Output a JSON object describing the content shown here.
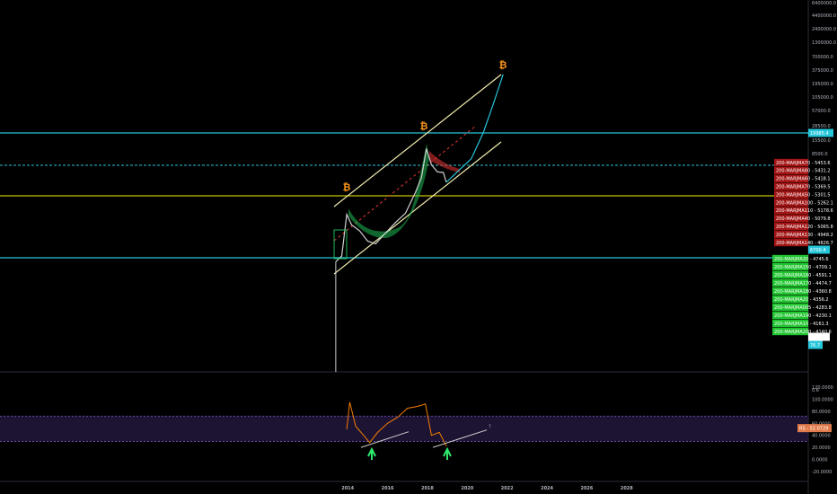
{
  "chart_data": [
    {
      "type": "line",
      "title": "",
      "y_scale": "log",
      "x_ticks": [
        "2014",
        "2016",
        "2018",
        "2020",
        "2022",
        "2024",
        "2026",
        "2028"
      ],
      "y_ticks": [
        "6400000.0",
        "4400000.0",
        "2400000.0",
        "1300000.0",
        "700000.0",
        "375000.0",
        "195000.0",
        "105000.0",
        "57000.0",
        "28500.0",
        "15500.0",
        "8500.0",
        "0.6"
      ],
      "price_label": "19985.4",
      "current_price_label": "1183.6",
      "level_tags": [
        {
          "text": "6700.4",
          "color": "#00bcd4"
        },
        {
          "text": "76.7",
          "color": "#00bcd4"
        }
      ],
      "ma_labels_red": [
        {
          "name": "200-MARJMA70",
          "value": "5453.6"
        },
        {
          "name": "200-MARJMA80",
          "value": "5431.2"
        },
        {
          "name": "200-MARJMA60",
          "value": "5418.1"
        },
        {
          "name": "200-MARJMA70",
          "value": "5369.5"
        },
        {
          "name": "200-MARJMA50",
          "value": "5301.5"
        },
        {
          "name": "200-MARJMA100",
          "value": "5262.1"
        },
        {
          "name": "200-MARJMA110",
          "value": "5178.6"
        },
        {
          "name": "200-MARJMA40",
          "value": "5079.8"
        },
        {
          "name": "200-MARJMA120",
          "value": "5065.8"
        },
        {
          "name": "200-MARJMA130",
          "value": "4948.2"
        },
        {
          "name": "200-MARJMA140",
          "value": "4826.7"
        }
      ],
      "ma_labels_green": [
        {
          "name": "200-MARJMA30",
          "value": "4745.6"
        },
        {
          "name": "200-MARJMA150",
          "value": "4709.1"
        },
        {
          "name": "200-MARJMA160",
          "value": "4591.1"
        },
        {
          "name": "200-MARJMA170",
          "value": "4474.7"
        },
        {
          "name": "200-MARJMA180",
          "value": "4360.8"
        },
        {
          "name": "200-MARJMA20",
          "value": "4356.2"
        },
        {
          "name": "200-MARJMA005",
          "value": "4283.8"
        },
        {
          "name": "200-MARJMA190",
          "value": "4230.1"
        },
        {
          "name": "200-MARJMA10",
          "value": "4161.3"
        },
        {
          "name": "200-MARJMA200",
          "value": "4140.6"
        }
      ],
      "markers": [
        {
          "symbol": "₿"
        },
        {
          "symbol": "₿"
        },
        {
          "symbol": "₿"
        }
      ],
      "series": [
        {
          "values": [
            {
              "x": 2013.4,
              "y": 100
            },
            {
              "x": 2013.7,
              "y": 130
            },
            {
              "x": 2013.95,
              "y": 900
            },
            {
              "x": 2014.2,
              "y": 550
            },
            {
              "x": 2014.6,
              "y": 420
            },
            {
              "x": 2015.0,
              "y": 260
            },
            {
              "x": 2015.4,
              "y": 230
            },
            {
              "x": 2015.9,
              "y": 380
            },
            {
              "x": 2016.4,
              "y": 620
            },
            {
              "x": 2016.9,
              "y": 950
            },
            {
              "x": 2017.4,
              "y": 2500
            },
            {
              "x": 2017.7,
              "y": 5000
            },
            {
              "x": 2017.95,
              "y": 19000
            },
            {
              "x": 2018.2,
              "y": 9000
            },
            {
              "x": 2018.5,
              "y": 6500
            },
            {
              "x": 2018.8,
              "y": 6300
            },
            {
              "x": 2018.95,
              "y": 4000
            }
          ]
        }
      ],
      "projection": [
        {
          "x": 2018.95,
          "y": 4000
        },
        {
          "x": 2019.5,
          "y": 6500
        },
        {
          "x": 2020.2,
          "y": 12000
        },
        {
          "x": 2020.8,
          "y": 40000
        },
        {
          "x": 2021.3,
          "y": 150000
        },
        {
          "x": 2021.8,
          "y": 600000
        }
      ]
    },
    {
      "type": "line",
      "title": "",
      "y_ticks": [
        "120.0000",
        "100.0000",
        "80.0000",
        "60.0000",
        "40.0000",
        "20.0000",
        "0.0000",
        "-20.0000"
      ],
      "rsi_tag": "RS - 52.0729",
      "annotation": "?",
      "ylim": [
        -20,
        120
      ],
      "series": [
        {
          "values": [
            {
              "x": 2013.95,
              "y": 50
            },
            {
              "x": 2014.1,
              "y": 95
            },
            {
              "x": 2014.4,
              "y": 55
            },
            {
              "x": 2014.8,
              "y": 40
            },
            {
              "x": 2015.1,
              "y": 28
            },
            {
              "x": 2015.5,
              "y": 45
            },
            {
              "x": 2016.0,
              "y": 60
            },
            {
              "x": 2016.5,
              "y": 70
            },
            {
              "x": 2017.0,
              "y": 85
            },
            {
              "x": 2017.5,
              "y": 88
            },
            {
              "x": 2017.9,
              "y": 92
            },
            {
              "x": 2018.2,
              "y": 40
            },
            {
              "x": 2018.6,
              "y": 45
            },
            {
              "x": 2018.95,
              "y": 22
            }
          ]
        }
      ]
    }
  ]
}
